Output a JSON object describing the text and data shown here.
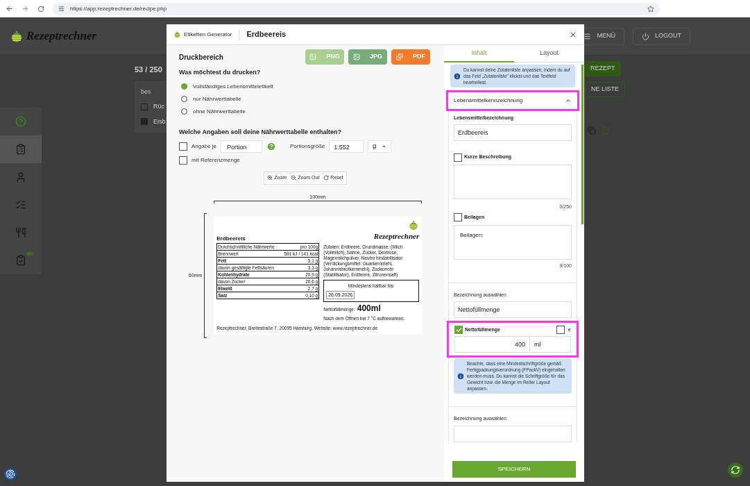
{
  "browser": {
    "url": "https://app.rezeptrechner.de/recipe.php"
  },
  "app": {
    "logo": "Rezeptrechner",
    "header_buttons": [
      {
        "label": "MENÜ",
        "kind": "menu"
      },
      {
        "label": "LOGOUT",
        "kind": "logout"
      }
    ],
    "counter": "53 / 250",
    "search_value": "bes",
    "rows": [
      {
        "label": "Rüc",
        "checked": false
      },
      {
        "label": "Eisb",
        "checked": true
      }
    ],
    "action_buttons": [
      {
        "label": "REZEPT",
        "kind": "primary"
      },
      {
        "label": "NE LISTE",
        "kind": "outline"
      }
    ],
    "sidebar": [
      {
        "kind": "help",
        "selected": false
      },
      {
        "kind": "recipes",
        "selected": true
      },
      {
        "kind": "user",
        "selected": false
      },
      {
        "kind": "list",
        "selected": false
      },
      {
        "kind": "dishes",
        "selected": false
      },
      {
        "kind": "clipboard",
        "selected": false
      }
    ]
  },
  "modal": {
    "app_name": "Etiketten Generator",
    "title": "Erdbeereis",
    "left": {
      "heading": "Druckbereich",
      "export_buttons": [
        {
          "label": "PNG",
          "kind": "image",
          "color": "#a8cf90"
        },
        {
          "label": "JPG",
          "kind": "image",
          "color": "#79ab7b"
        },
        {
          "label": "PDF",
          "kind": "pdf",
          "color": "#f27c2b"
        }
      ],
      "print_question": "Was möchtest du drucken?",
      "print_options": [
        {
          "label": "Vollständiges Lebensmitteletikett",
          "selected": true
        },
        {
          "label": "nur Nährwerttabelle",
          "selected": false
        },
        {
          "label": "ohne Nährwerttabelle",
          "selected": false
        }
      ],
      "nutrition_question": "Welche Angaben soll deine Nährwerttabelle enthalten?",
      "per_unit": {
        "label": "Angabe je",
        "checked": false,
        "value": "Portion"
      },
      "portion_size": {
        "label": "Portionsgröße",
        "value": "1.552",
        "unit": "g"
      },
      "reference": {
        "label": "mit Referenzmenge",
        "checked": false
      },
      "zoom_buttons": [
        {
          "label": "Zoom",
          "kind": "zoom_in"
        },
        {
          "label": "Zoom Out",
          "kind": "zoom_out"
        },
        {
          "label": "Reset",
          "kind": "reset"
        }
      ],
      "ruler": {
        "width": "100mm",
        "height": "60mm"
      },
      "label": {
        "name": "Erdbeereis",
        "logo": "Rezeptrechner",
        "nutrition": [
          {
            "name": "Durchschnittliche Nährwerte",
            "value": "pro 100g",
            "bold": false
          },
          {
            "name": "Brennwert",
            "value": "591 kJ / 141 kcal",
            "bold": false
          },
          {
            "name": "Fett",
            "value": "5,1 g",
            "bold": true
          },
          {
            "name": "davon gesättigte Fettsäuren",
            "value": "3,3 g",
            "bold": false
          },
          {
            "name": "Kohlenhydrate",
            "value": "20,9 g",
            "bold": true
          },
          {
            "name": "davon Zucker",
            "value": "20,6 g",
            "bold": false
          },
          {
            "name": "Eiweiß",
            "value": "2,7 g",
            "bold": true
          },
          {
            "name": "Salz",
            "value": "0,10 g",
            "bold": true
          }
        ],
        "ingredients": "Zutaten: Erdbeere, Grundmasse: (Milch (Vollmilch), Sahne, Zucker, Dextrose, Magermilchpulver, Neutro bindabilisator (Verdickungsmittel: Guarkernmehl, Johannisbrotkernmehl), Zuckerrohr (Stabilisator), Erdbeere, Zitronensaft)",
        "best_before_label": "Mindestens haltbar bis:",
        "best_before": "26.05.2026",
        "net_label": "Nettofüllmenge:",
        "net_value": "400ml",
        "storage": "Nach dem Öffnen bei 7 °C aufbewahren.",
        "footer": "Rezeptrechner, Breitestraße 7, 20095 Hamburg, Website: www.rezeptrechner.de"
      }
    }
  },
  "right": {
    "tabs": [
      {
        "label": "Inhalt",
        "selected": true
      },
      {
        "label": "Layout",
        "selected": false
      }
    ],
    "info_top": "Du kannst deine Zutatenliste anpassen, indem du auf das Feld „Zutatenliste\" klickst und das Textfeld bearbeitest.",
    "accordion": {
      "title": "Lebensmittelkennzeichnung",
      "expanded": true,
      "highlighted": true
    },
    "name_field": {
      "label": "Lebensmittelbezeichnung",
      "value": "Erdbeereis"
    },
    "description": {
      "label": "Kurze Beschreibung",
      "checked": false,
      "counter": "0/250"
    },
    "sides": {
      "label": "Beilagen",
      "checked": false,
      "value": "Beilagen:",
      "counter": "9/100"
    },
    "designation": {
      "label": "Bezeichnung auswählen",
      "value": "Nettofüllmenge"
    },
    "net": {
      "label": "Nettofüllmenge",
      "checked": true,
      "e_label": "e",
      "e_checked": false,
      "value": "400",
      "unit": "ml",
      "highlighted": true
    },
    "info_bottom": "Beachte, dass eine Mindestschriftgröße gemäß Fertigpackungsverordnung (FPackV) eingehalten werden muss. Du kannst die Schriftgröße für das Gewicht bzw. die Menge im Reiter Layout anpassen.",
    "designation2": {
      "label": "Bezeichnung auswählen"
    },
    "save": "SPEICHERN"
  }
}
